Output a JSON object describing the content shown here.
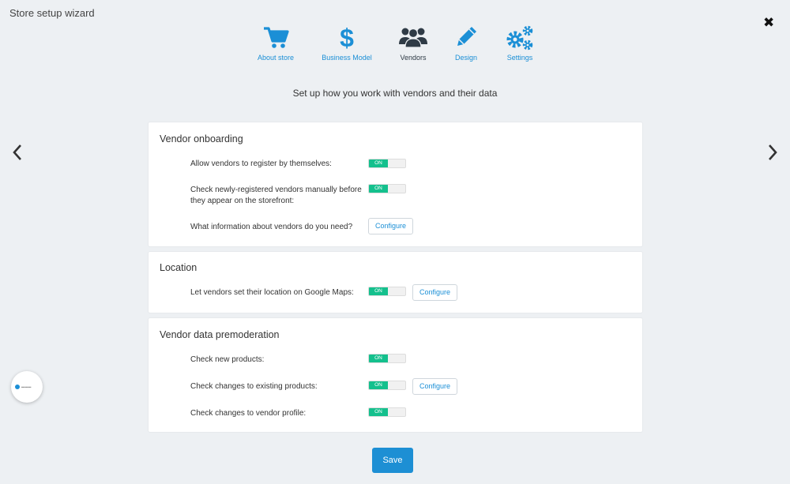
{
  "window": {
    "title": "Store setup wizard",
    "close_icon": "close-icon"
  },
  "steps": [
    {
      "label": "About store",
      "icon": "cart-icon"
    },
    {
      "label": "Business Model",
      "icon": "dollar-icon"
    },
    {
      "label": "Vendors",
      "icon": "users-icon",
      "active": true
    },
    {
      "label": "Design",
      "icon": "pencil-icon"
    },
    {
      "label": "Settings",
      "icon": "gears-icon"
    }
  ],
  "subtitle": "Set up how you work with vendors and their data",
  "nav": {
    "prev_icon": "chevron-left-icon",
    "next_icon": "chevron-right-icon"
  },
  "sections": {
    "onboarding": {
      "title": "Vendor onboarding",
      "rows": [
        {
          "label": "Allow vendors to register by themselves:",
          "toggle": "ON"
        },
        {
          "label": "Check newly-registered vendors manually before they appear on the storefront:",
          "toggle": "ON"
        },
        {
          "label": "What information about vendors do you need?",
          "button": "Configure"
        }
      ]
    },
    "location": {
      "title": "Location",
      "rows": [
        {
          "label": "Let vendors set their location on Google Maps:",
          "toggle": "ON",
          "button": "Configure"
        }
      ]
    },
    "premoderation": {
      "title": "Vendor data premoderation",
      "rows": [
        {
          "label": "Check new products:",
          "toggle": "ON"
        },
        {
          "label": "Check changes to existing products:",
          "toggle": "ON",
          "button": "Configure"
        },
        {
          "label": "Check changes to vendor profile:",
          "toggle": "ON"
        }
      ]
    }
  },
  "save_label": "Save",
  "colors": {
    "accent": "#1b8fd6",
    "toggle_on": "#14c08d",
    "background": "#edf0f3"
  }
}
